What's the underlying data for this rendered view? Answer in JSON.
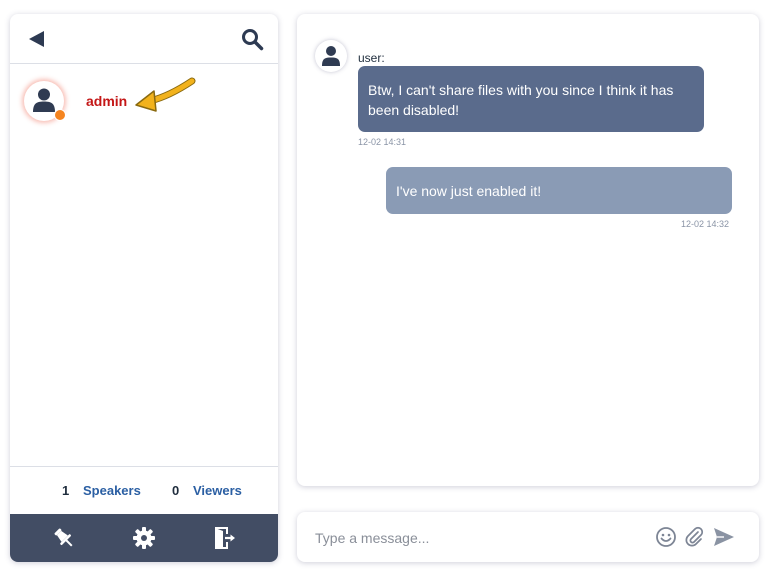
{
  "sidebar": {
    "users": [
      {
        "name": "admin",
        "status": "away"
      }
    ],
    "counts": {
      "speakers_count": "1",
      "speakers_label": "Speakers",
      "viewers_count": "0",
      "viewers_label": "Viewers"
    },
    "toolbar_icons": [
      "pin-icon",
      "gear-icon",
      "exit-icon"
    ]
  },
  "chat": {
    "messages": [
      {
        "sender": "user:",
        "text": "Btw, I can't share files with you since I think it has been disabled!",
        "time": "12-02 14:31",
        "direction": "incoming"
      },
      {
        "sender": "",
        "text": "I've now just enabled it!",
        "time": "12-02 14:32",
        "direction": "outgoing"
      }
    ]
  },
  "composer": {
    "placeholder": "Type a message...",
    "icons": [
      "emoji-icon",
      "attachment-icon",
      "send-icon"
    ]
  },
  "colors": {
    "toolbar_bg": "#424d64",
    "incoming_bubble": "#5a6b8c",
    "outgoing_bubble": "#8a9bb5",
    "username": "#c41717",
    "status_away": "#f5841f",
    "link_blue": "#2b5fa3",
    "annotation_arrow": "#f2b21c"
  }
}
